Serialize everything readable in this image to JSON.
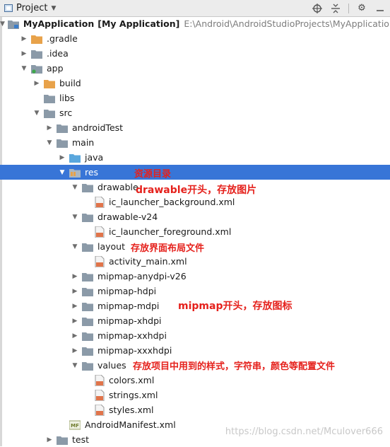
{
  "toolbar": {
    "view_label": "Project",
    "icons": [
      "project-view-icon",
      "chevron-down-icon",
      "target-icon",
      "collapse-icon",
      "gear-icon",
      "minimize-icon"
    ]
  },
  "tree": {
    "root": {
      "name": "MyApplication",
      "module": "[My Application]",
      "path": "E:\\Android\\AndroidStudioProjects\\MyApplication"
    },
    "gradle": ".gradle",
    "idea": ".idea",
    "app": "app",
    "build": "build",
    "libs": "libs",
    "src": "src",
    "androidTest": "androidTest",
    "main": "main",
    "java": "java",
    "res": "res",
    "drawable": "drawable",
    "ic_launcher_background": "ic_launcher_background.xml",
    "drawable_v24": "drawable-v24",
    "ic_launcher_foreground": "ic_launcher_foreground.xml",
    "layout": "layout",
    "activity_main": "activity_main.xml",
    "mipmap_anydpi": "mipmap-anydpi-v26",
    "mipmap_hdpi": "mipmap-hdpi",
    "mipmap_mdpi": "mipmap-mdpi",
    "mipmap_xhdpi": "mipmap-xhdpi",
    "mipmap_xxhdpi": "mipmap-xxhdpi",
    "mipmap_xxxhdpi": "mipmap-xxxhdpi",
    "values": "values",
    "colors": "colors.xml",
    "strings": "strings.xml",
    "styles": "styles.xml",
    "manifest": "AndroidManifest.xml",
    "test": "test"
  },
  "annotations": {
    "res": "资源目录",
    "drawable": "drawable开头，存放图片",
    "layout": "存放界面布局文件",
    "mipmap": "mipmap开头，存放图标",
    "values": "存放项目中用到的样式，字符串，颜色等配置文件"
  },
  "watermark": "https://blog.csdn.net/Mculover666",
  "colors": {
    "selection": "#3875d7",
    "annotation": "#e5211c",
    "folder": "#8b9aa8",
    "folder_orange": "#e8a24a",
    "folder_blue": "#5aa7dd"
  }
}
